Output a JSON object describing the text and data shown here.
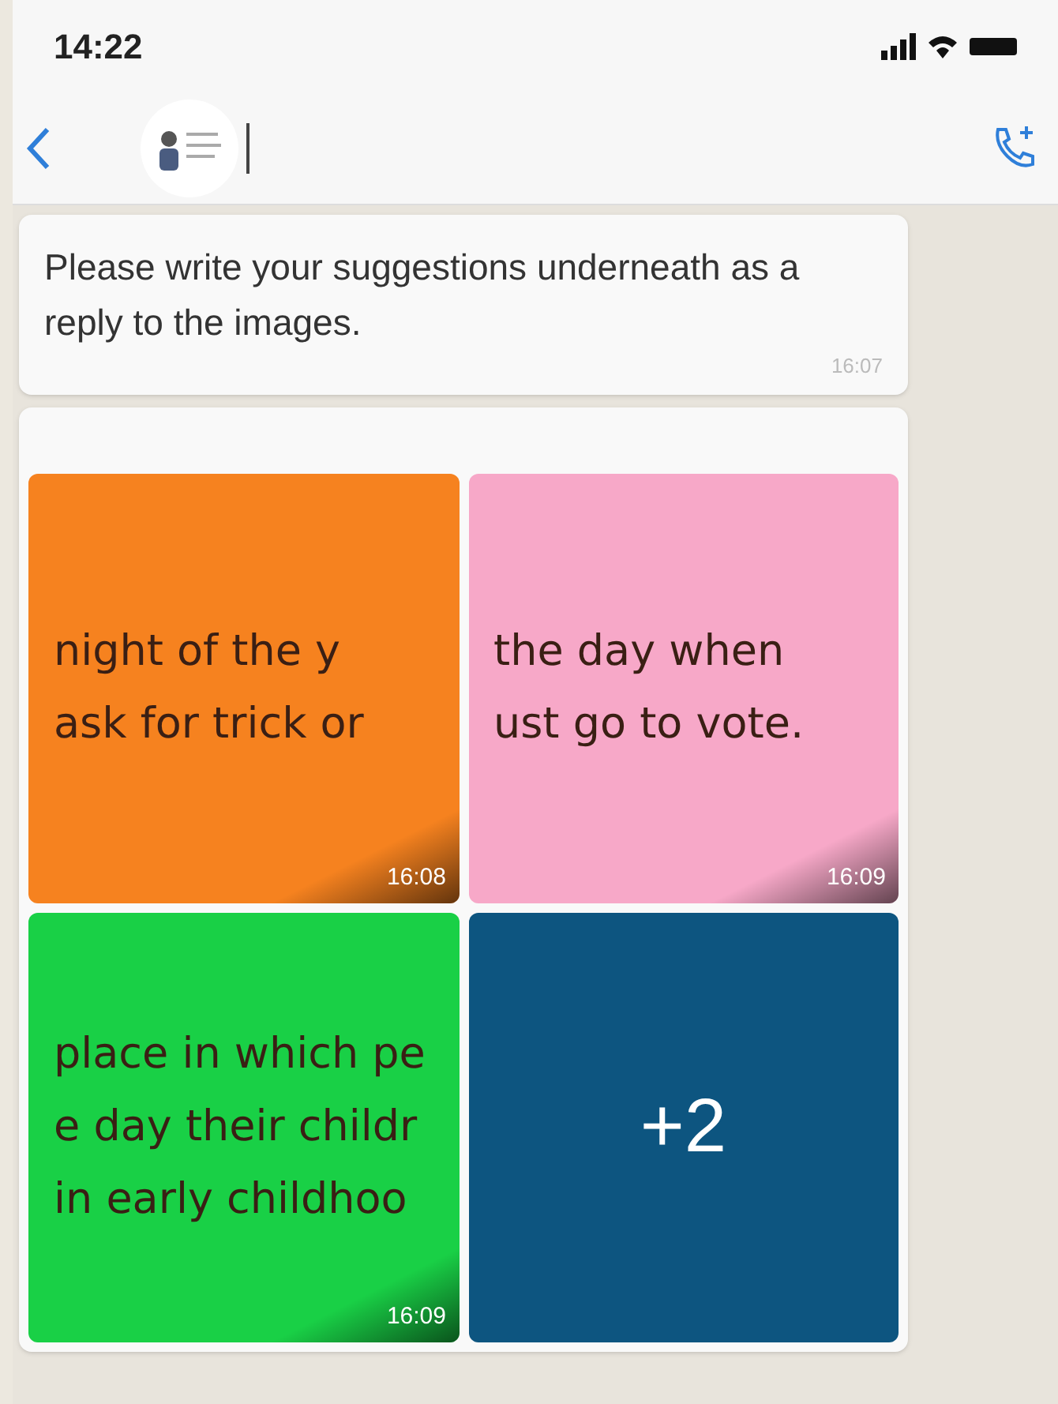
{
  "status_bar": {
    "time": "14:22"
  },
  "message": {
    "text": "Please write your suggestions underneath as a reply to the images.",
    "time": "16:07"
  },
  "album": {
    "tiles": [
      {
        "kind": "text",
        "color": "#f6821f",
        "lines": [
          "night of the y",
          "ask for trick or"
        ],
        "time": "16:08"
      },
      {
        "kind": "text",
        "color": "#f7a8c8",
        "lines": [
          "the day when",
          "ust go to vote."
        ],
        "time": "16:09"
      },
      {
        "kind": "text",
        "color": "#19d046",
        "lines": [
          "place in which pe",
          "e day their childr",
          "in early childhoo"
        ],
        "time": "16:09"
      },
      {
        "kind": "more",
        "color": "#0d5580",
        "count": "+2"
      }
    ]
  }
}
